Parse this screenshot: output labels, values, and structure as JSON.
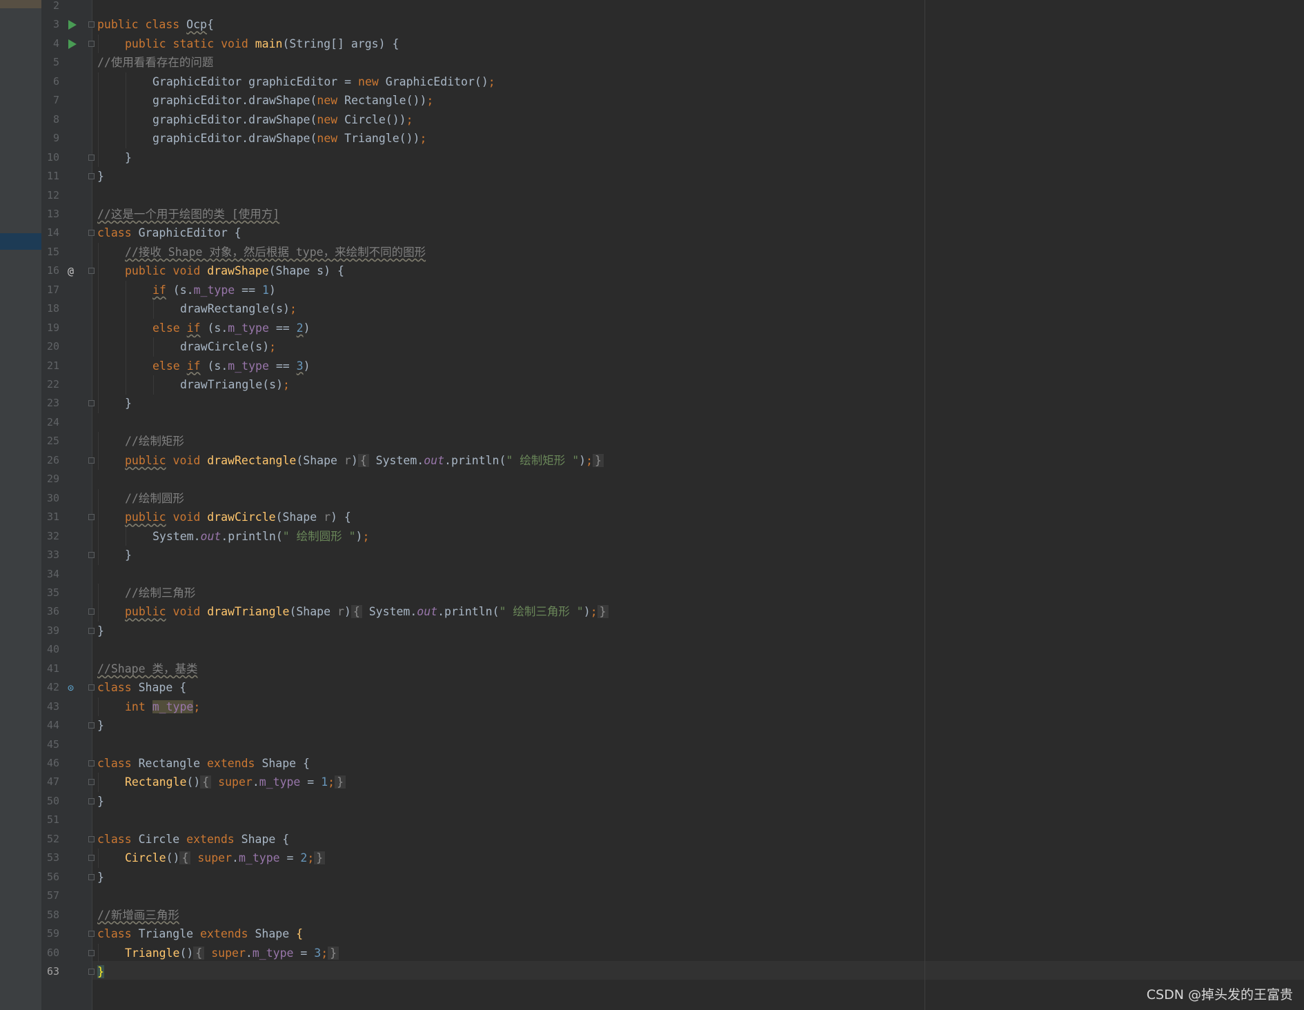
{
  "watermark": "CSDN @掉头发的王富贵",
  "lines": [
    {
      "n": "2",
      "tokens": []
    },
    {
      "n": "3",
      "icon": "run",
      "fold": true,
      "indent": 0,
      "tokens": [
        [
          "kw",
          "public class "
        ],
        [
          "ul",
          "Ocp"
        ],
        [
          "",
          "{"
        ]
      ]
    },
    {
      "n": "4",
      "icon": "run",
      "fold": true,
      "indent": 1,
      "tokens": [
        [
          "kw",
          "public static void "
        ],
        [
          "fn",
          "main"
        ],
        [
          "",
          "(String[] args) {"
        ]
      ]
    },
    {
      "n": "5",
      "indent": 0,
      "tokens": [
        [
          "cm",
          "//使用看看存在的问题"
        ]
      ]
    },
    {
      "n": "6",
      "indent": 2,
      "tokens": [
        [
          "",
          "GraphicEditor graphicEditor = "
        ],
        [
          "kw",
          "new "
        ],
        [
          "",
          "GraphicEditor()"
        ],
        [
          "kw",
          ";"
        ]
      ]
    },
    {
      "n": "7",
      "indent": 2,
      "tokens": [
        [
          "",
          "graphicEditor.drawShape("
        ],
        [
          "kw",
          "new "
        ],
        [
          "",
          "Rectangle())"
        ],
        [
          "kw",
          ";"
        ]
      ]
    },
    {
      "n": "8",
      "indent": 2,
      "tokens": [
        [
          "",
          "graphicEditor.drawShape("
        ],
        [
          "kw",
          "new "
        ],
        [
          "",
          "Circle())"
        ],
        [
          "kw",
          ";"
        ]
      ]
    },
    {
      "n": "9",
      "indent": 2,
      "tokens": [
        [
          "",
          "graphicEditor.drawShape("
        ],
        [
          "kw",
          "new "
        ],
        [
          "",
          "Triangle())"
        ],
        [
          "kw",
          ";"
        ]
      ]
    },
    {
      "n": "10",
      "fold": true,
      "indent": 1,
      "tokens": [
        [
          "",
          "}"
        ]
      ]
    },
    {
      "n": "11",
      "fold": true,
      "indent": 0,
      "tokens": [
        [
          "",
          "}"
        ]
      ]
    },
    {
      "n": "12",
      "tokens": []
    },
    {
      "n": "13",
      "indent": 0,
      "tokens": [
        [
          "cm ul",
          "//这是一个用于绘图的类 [使用方]"
        ]
      ]
    },
    {
      "n": "14",
      "fold": true,
      "indent": 0,
      "tokens": [
        [
          "kw",
          "class "
        ],
        [
          "",
          "GraphicEditor {"
        ]
      ]
    },
    {
      "n": "15",
      "indent": 1,
      "tokens": [
        [
          "cm ul",
          "//接收 Shape 对象，然后根据 type，来绘制不同的图形"
        ]
      ]
    },
    {
      "n": "16",
      "icon": "at",
      "fold": true,
      "indent": 1,
      "tokens": [
        [
          "kw",
          "public void "
        ],
        [
          "fn",
          "drawShape"
        ],
        [
          "",
          "(Shape s) {"
        ]
      ]
    },
    {
      "n": "17",
      "indent": 2,
      "tokens": [
        [
          "kw ul",
          "if"
        ],
        [
          "",
          " (s."
        ],
        [
          "fld",
          "m_type"
        ],
        [
          "",
          " == "
        ],
        [
          "num",
          "1"
        ],
        [
          "",
          ")"
        ]
      ]
    },
    {
      "n": "18",
      "indent": 3,
      "tokens": [
        [
          "",
          "drawRectangle(s)"
        ],
        [
          "kw",
          ";"
        ]
      ]
    },
    {
      "n": "19",
      "indent": 2,
      "tokens": [
        [
          "kw",
          "else "
        ],
        [
          "kw ul",
          "if"
        ],
        [
          "",
          " (s."
        ],
        [
          "fld",
          "m_type"
        ],
        [
          "",
          " == "
        ],
        [
          "num ul",
          "2"
        ],
        [
          "",
          ")"
        ]
      ]
    },
    {
      "n": "20",
      "indent": 3,
      "tokens": [
        [
          "",
          "drawCircle(s)"
        ],
        [
          "kw",
          ";"
        ]
      ]
    },
    {
      "n": "21",
      "indent": 2,
      "tokens": [
        [
          "kw",
          "else "
        ],
        [
          "kw ul",
          "if"
        ],
        [
          "",
          " (s."
        ],
        [
          "fld",
          "m_type"
        ],
        [
          "",
          " == "
        ],
        [
          "num ul",
          "3"
        ],
        [
          "",
          ")"
        ]
      ]
    },
    {
      "n": "22",
      "indent": 3,
      "tokens": [
        [
          "",
          "drawTriangle(s)"
        ],
        [
          "kw",
          ";"
        ]
      ]
    },
    {
      "n": "23",
      "fold": true,
      "indent": 1,
      "tokens": [
        [
          "",
          "}"
        ]
      ]
    },
    {
      "n": "24",
      "tokens": []
    },
    {
      "n": "25",
      "indent": 1,
      "tokens": [
        [
          "cm",
          "//绘制矩形"
        ]
      ]
    },
    {
      "n": "26",
      "fold": true,
      "indent": 1,
      "tokens": [
        [
          "kw ul",
          "public"
        ],
        [
          "kw",
          " void "
        ],
        [
          "fn",
          "drawRectangle"
        ],
        [
          "",
          "(Shape "
        ],
        [
          "cm",
          "r"
        ],
        [
          "",
          ")"
        ],
        [
          "fold-bg",
          "{"
        ],
        [
          "",
          " System."
        ],
        [
          "ital",
          "out"
        ],
        [
          "",
          ".println("
        ],
        [
          "str",
          "\" 绘制矩形 \""
        ],
        [
          "",
          ")"
        ],
        [
          "kw",
          ";"
        ],
        [
          "fold-bg",
          "}"
        ]
      ]
    },
    {
      "n": "29",
      "tokens": []
    },
    {
      "n": "30",
      "indent": 1,
      "tokens": [
        [
          "cm",
          "//绘制圆形"
        ]
      ]
    },
    {
      "n": "31",
      "fold": true,
      "indent": 1,
      "tokens": [
        [
          "kw ul",
          "public"
        ],
        [
          "kw",
          " void "
        ],
        [
          "fn",
          "drawCircle"
        ],
        [
          "",
          "(Shape "
        ],
        [
          "cm",
          "r"
        ],
        [
          "",
          ") {"
        ]
      ]
    },
    {
      "n": "32",
      "indent": 2,
      "tokens": [
        [
          "",
          "System."
        ],
        [
          "ital",
          "out"
        ],
        [
          "",
          ".println("
        ],
        [
          "str",
          "\" 绘制圆形 \""
        ],
        [
          "",
          ")"
        ],
        [
          "kw",
          ";"
        ]
      ]
    },
    {
      "n": "33",
      "fold": true,
      "indent": 1,
      "tokens": [
        [
          "",
          "}"
        ]
      ]
    },
    {
      "n": "34",
      "tokens": []
    },
    {
      "n": "35",
      "indent": 1,
      "tokens": [
        [
          "cm",
          "//绘制三角形"
        ]
      ]
    },
    {
      "n": "36",
      "fold": true,
      "indent": 1,
      "tokens": [
        [
          "kw ul",
          "public"
        ],
        [
          "kw",
          " void "
        ],
        [
          "fn",
          "drawTriangle"
        ],
        [
          "",
          "(Shape "
        ],
        [
          "cm",
          "r"
        ],
        [
          "",
          ")"
        ],
        [
          "fold-bg",
          "{"
        ],
        [
          "",
          " System."
        ],
        [
          "ital",
          "out"
        ],
        [
          "",
          ".println("
        ],
        [
          "str",
          "\" 绘制三角形 \""
        ],
        [
          "",
          ")"
        ],
        [
          "kw",
          ";"
        ],
        [
          "fold-bg",
          "}"
        ]
      ]
    },
    {
      "n": "39",
      "fold": true,
      "indent": 0,
      "tokens": [
        [
          "",
          "}"
        ]
      ]
    },
    {
      "n": "40",
      "tokens": []
    },
    {
      "n": "41",
      "indent": 0,
      "tokens": [
        [
          "cm ul",
          "//Shape 类，基类"
        ]
      ]
    },
    {
      "n": "42",
      "icon": "impl",
      "fold": true,
      "indent": 0,
      "tokens": [
        [
          "kw",
          "class "
        ],
        [
          "",
          "Shape {"
        ]
      ]
    },
    {
      "n": "43",
      "indent": 1,
      "tokens": [
        [
          "kw",
          "int "
        ],
        [
          "fld hl-field",
          "m_type"
        ],
        [
          "kw",
          ";"
        ]
      ]
    },
    {
      "n": "44",
      "fold": true,
      "indent": 0,
      "tokens": [
        [
          "",
          "}"
        ]
      ]
    },
    {
      "n": "45",
      "tokens": []
    },
    {
      "n": "46",
      "fold": true,
      "indent": 0,
      "tokens": [
        [
          "kw",
          "class "
        ],
        [
          "",
          "Rectangle "
        ],
        [
          "kw",
          "extends "
        ],
        [
          "",
          "Shape {"
        ]
      ]
    },
    {
      "n": "47",
      "fold": true,
      "indent": 1,
      "tokens": [
        [
          "fn",
          "Rectangle"
        ],
        [
          "",
          "()"
        ],
        [
          "fold-bg",
          "{"
        ],
        [
          " kw",
          "super"
        ],
        [
          "",
          "."
        ],
        [
          "fld",
          "m_type"
        ],
        [
          "",
          " = "
        ],
        [
          "num",
          "1"
        ],
        [
          "kw",
          ";"
        ],
        [
          "fold-bg",
          "}"
        ]
      ]
    },
    {
      "n": "50",
      "fold": true,
      "indent": 0,
      "tokens": [
        [
          "",
          "}"
        ]
      ]
    },
    {
      "n": "51",
      "tokens": []
    },
    {
      "n": "52",
      "fold": true,
      "indent": 0,
      "tokens": [
        [
          "kw",
          "class "
        ],
        [
          "",
          "Circle "
        ],
        [
          "kw",
          "extends "
        ],
        [
          "",
          "Shape {"
        ]
      ]
    },
    {
      "n": "53",
      "fold": true,
      "indent": 1,
      "tokens": [
        [
          "fn",
          "Circle"
        ],
        [
          "",
          "()"
        ],
        [
          "fold-bg",
          "{"
        ],
        [
          " kw",
          "super"
        ],
        [
          "",
          "."
        ],
        [
          "fld",
          "m_type"
        ],
        [
          "",
          " = "
        ],
        [
          "num",
          "2"
        ],
        [
          "kw",
          ";"
        ],
        [
          "fold-bg",
          "}"
        ]
      ]
    },
    {
      "n": "56",
      "fold": true,
      "indent": 0,
      "tokens": [
        [
          "",
          "}"
        ]
      ]
    },
    {
      "n": "57",
      "tokens": []
    },
    {
      "n": "58",
      "indent": 0,
      "tokens": [
        [
          "cm ul",
          "//新增画三角形"
        ]
      ]
    },
    {
      "n": "59",
      "fold": true,
      "indent": 0,
      "tokens": [
        [
          "kw",
          "class "
        ],
        [
          "",
          "Triangle "
        ],
        [
          "kw",
          "extends "
        ],
        [
          "",
          "Shape "
        ],
        [
          "fn",
          "{"
        ]
      ]
    },
    {
      "n": "60",
      "fold": true,
      "indent": 1,
      "tokens": [
        [
          "fn",
          "Triangle"
        ],
        [
          "",
          "()"
        ],
        [
          "fold-bg",
          "{"
        ],
        [
          " kw",
          "super"
        ],
        [
          "",
          "."
        ],
        [
          "fld",
          "m_type"
        ],
        [
          "",
          " = "
        ],
        [
          "num",
          "3"
        ],
        [
          "kw",
          ";"
        ],
        [
          "fold-bg",
          "}"
        ]
      ]
    },
    {
      "n": "63",
      "current": true,
      "fold": true,
      "indent": 0,
      "tokens": [
        [
          "cursor-brace",
          "}"
        ]
      ]
    }
  ]
}
